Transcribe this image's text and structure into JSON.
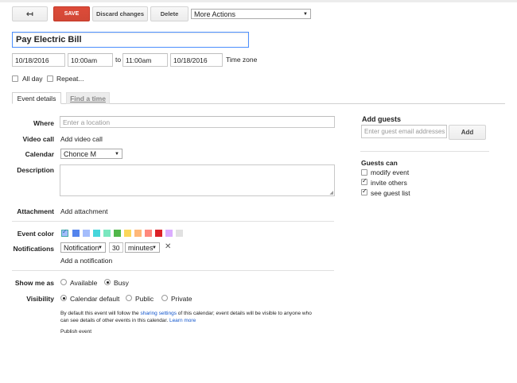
{
  "toolbar": {
    "back_icon": "back-arrow-icon",
    "save_label": "SAVE",
    "discard_label": "Discard changes",
    "delete_label": "Delete",
    "more_actions_value": "More Actions"
  },
  "event": {
    "title": "Pay Electric Bill",
    "start_date": "10/18/2016",
    "start_time": "10:00am",
    "to_label": "to",
    "end_time": "11:00am",
    "end_date": "10/18/2016",
    "time_zone_link": "Time zone",
    "all_day_label": "All day",
    "all_day_checked": false,
    "repeat_label": "Repeat...",
    "repeat_checked": false
  },
  "tabs": {
    "details": "Event details",
    "find_time": "Find a time"
  },
  "details": {
    "where_label": "Where",
    "where_placeholder": "Enter a location",
    "video_label": "Video call",
    "video_link": "Add video call",
    "calendar_label": "Calendar",
    "calendar_value": "Chonce M",
    "description_label": "Description",
    "attachment_label": "Attachment",
    "attachment_link": "Add attachment",
    "color_label": "Event color",
    "colors": [
      "#a4bdfc",
      "#5484ed",
      "#a4bdfc",
      "#46d6db",
      "#7ae7bf",
      "#51b749",
      "#fbd75b",
      "#ffb878",
      "#ff887c",
      "#dc2127",
      "#dbadff",
      "#e1e1e1"
    ],
    "notifications_label": "Notifications",
    "notification_type": "Notification",
    "notification_amount": "30",
    "notification_unit": "minutes",
    "remove_icon": "close-icon",
    "add_notification_link": "Add a notification",
    "show_me_as_label": "Show me as",
    "available_label": "Available",
    "busy_label": "Busy",
    "visibility_label": "Visibility",
    "calendar_default_label": "Calendar default",
    "public_label": "Public",
    "private_label": "Private",
    "visibility_note_1": "By default this event will follow the",
    "sharing_settings_link": "sharing settings",
    "visibility_note_2": "of this calendar; event details will be visible to anyone who",
    "visibility_note_3": "can see details of other events in this calendar.",
    "learn_more_link": "Learn more",
    "publish_link": "Publish event"
  },
  "guests": {
    "heading": "Add guests",
    "input_placeholder": "Enter guest email addresses",
    "add_button": "Add",
    "guests_can_heading": "Guests can",
    "modify_label": "modify event",
    "modify_checked": false,
    "invite_label": "invite others",
    "invite_checked": true,
    "see_list_label": "see guest list",
    "see_list_checked": true
  }
}
